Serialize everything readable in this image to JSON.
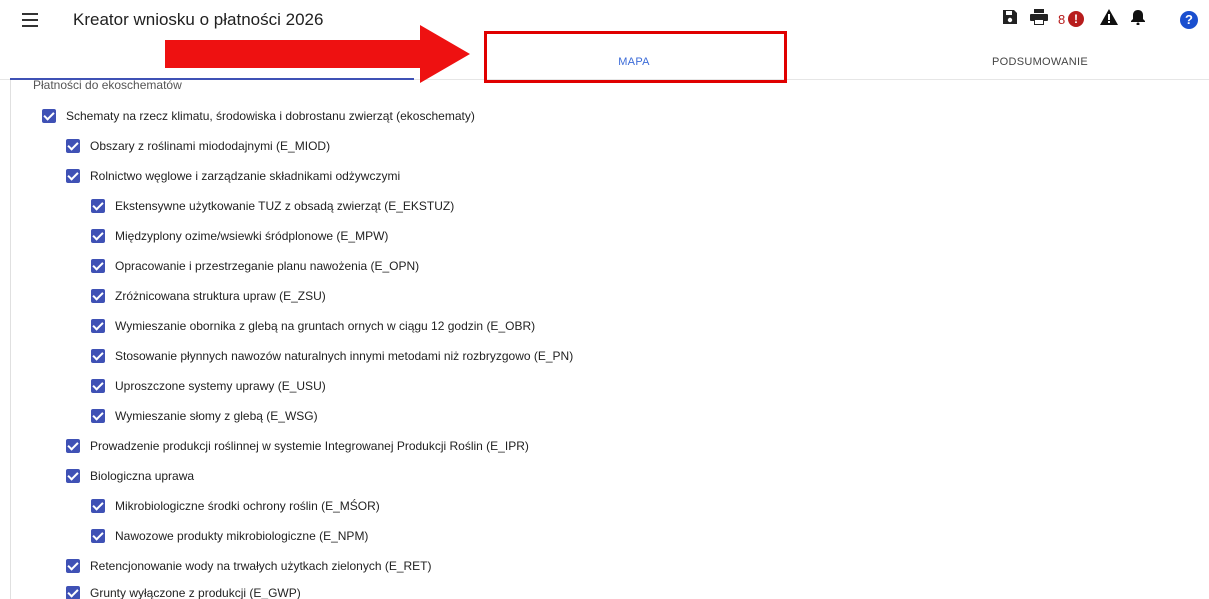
{
  "app": {
    "title": "Kreator wniosku o płatności 2026"
  },
  "toolbar": {
    "save_icon": "save-icon",
    "print_icon": "print-icon",
    "error_count": "8",
    "error_glyph": "!",
    "warning_icon": "warning-icon",
    "bell_icon": "bell-icon",
    "help_glyph": "?"
  },
  "tabs": [
    {
      "label": ""
    },
    {
      "label": "MAPA"
    },
    {
      "label": "PODSUMOWANIE"
    }
  ],
  "section": {
    "title": "Płatności do ekoschematów"
  },
  "items": [
    {
      "label": "Schematy na rzecz klimatu, środowiska i dobrostanu zwierząt (ekoschematy)",
      "checked": true
    },
    {
      "label": "Obszary z roślinami miododajnymi (E_MIOD)",
      "checked": true
    },
    {
      "label": "Rolnictwo węglowe i zarządzanie składnikami odżywczymi",
      "checked": true
    },
    {
      "label": "Ekstensywne użytkowanie TUZ z obsadą zwierząt (E_EKSTUZ)",
      "checked": true
    },
    {
      "label": "Międzyplony ozime/wsiewki śródplonowe (E_MPW)",
      "checked": true
    },
    {
      "label": "Opracowanie i przestrzeganie planu nawożenia (E_OPN)",
      "checked": true
    },
    {
      "label": "Zróżnicowana struktura upraw (E_ZSU)",
      "checked": true
    },
    {
      "label": "Wymieszanie obornika z glebą na gruntach ornych w ciągu 12 godzin (E_OBR)",
      "checked": true
    },
    {
      "label": "Stosowanie płynnych nawozów naturalnych innymi metodami niż rozbryzgowo (E_PN)",
      "checked": true
    },
    {
      "label": "Uproszczone systemy uprawy (E_USU)",
      "checked": true
    },
    {
      "label": "Wymieszanie słomy z glebą (E_WSG)",
      "checked": true
    },
    {
      "label": "Prowadzenie produkcji roślinnej w systemie Integrowanej Produkcji Roślin (E_IPR)",
      "checked": true
    },
    {
      "label": "Biologiczna uprawa",
      "checked": true
    },
    {
      "label": "Mikrobiologiczne środki ochrony roślin (E_MŚOR)",
      "checked": true
    },
    {
      "label": "Nawozowe produkty mikrobiologiczne (E_NPM)",
      "checked": true
    },
    {
      "label": "Retencjonowanie wody na trwałych użytkach zielonych (E_RET)",
      "checked": true
    },
    {
      "label": "Grunty wyłączone z produkcji (E_GWP)",
      "checked": true
    }
  ],
  "colors": {
    "accent": "#3f51b5",
    "highlight": "#e00000",
    "error": "#b71c1c",
    "help": "#1a4fcf"
  }
}
